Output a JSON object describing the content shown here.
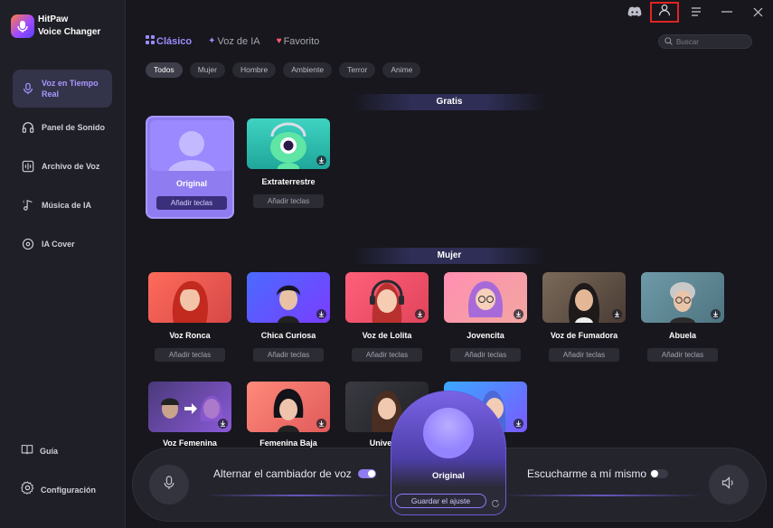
{
  "brand": {
    "line1": "HitPaw",
    "line2": "Voice Changer"
  },
  "sidebar": {
    "items": [
      {
        "label": "Voz en Tiempo Real",
        "icon": "microphone-icon",
        "active": true
      },
      {
        "label": "Panel de Sonido",
        "icon": "headphones-icon",
        "active": false
      },
      {
        "label": "Archivo de Voz",
        "icon": "file-voice-icon",
        "active": false
      },
      {
        "label": "Música de IA",
        "icon": "music-note-icon",
        "active": false
      },
      {
        "label": "IA Cover",
        "icon": "cover-disc-icon",
        "active": false
      }
    ],
    "bottom": [
      {
        "label": "Guía",
        "icon": "book-icon"
      },
      {
        "label": "Configuración",
        "icon": "gear-icon"
      }
    ]
  },
  "tabs": [
    {
      "label": "Clásico",
      "icon": "grid-icon",
      "active": true
    },
    {
      "label": "Voz de IA",
      "icon": "sparkle-icon",
      "active": false
    },
    {
      "label": "Favorito",
      "icon": "heart-icon",
      "active": false
    }
  ],
  "search": {
    "placeholder": "Buscar"
  },
  "filters": [
    {
      "label": "Todos",
      "active": true
    },
    {
      "label": "Mujer",
      "active": false
    },
    {
      "label": "Hombre",
      "active": false
    },
    {
      "label": "Ambiente",
      "active": false
    },
    {
      "label": "Terror",
      "active": false
    },
    {
      "label": "Anime",
      "active": false
    }
  ],
  "sections": {
    "free": "Gratis",
    "woman": "Mujer"
  },
  "free_cards": [
    {
      "name": "Original",
      "keys": "Añadir teclas"
    },
    {
      "name": "Extraterrestre",
      "keys": "Añadir teclas"
    }
  ],
  "woman_cards": [
    {
      "name": "Voz Ronca",
      "keys": "Añadir teclas"
    },
    {
      "name": "Chica Curiosa",
      "keys": "Añadir teclas"
    },
    {
      "name": "Voz de Lolita",
      "keys": "Añadir teclas"
    },
    {
      "name": "Jovencita",
      "keys": "Añadir teclas"
    },
    {
      "name": "Voz de Fumadora",
      "keys": "Añadir teclas"
    },
    {
      "name": "Abuela",
      "keys": "Añadir teclas"
    }
  ],
  "partial_cards": [
    {
      "name": "Voz Femenina"
    },
    {
      "name": "Femenina Baja"
    },
    {
      "name": "Universo"
    }
  ],
  "controls": {
    "toggle_changer_label": "Alternar el cambiador de voz",
    "toggle_changer_on": true,
    "hear_myself_label": "Escucharme a mí mismo",
    "hear_myself_on": false
  },
  "current_voice": {
    "name": "Original",
    "save_label": "Guardar el ajuste"
  },
  "colors": {
    "accent": "#8f7cf0",
    "bg": "#17171d",
    "sidebar": "#1f1f27"
  }
}
